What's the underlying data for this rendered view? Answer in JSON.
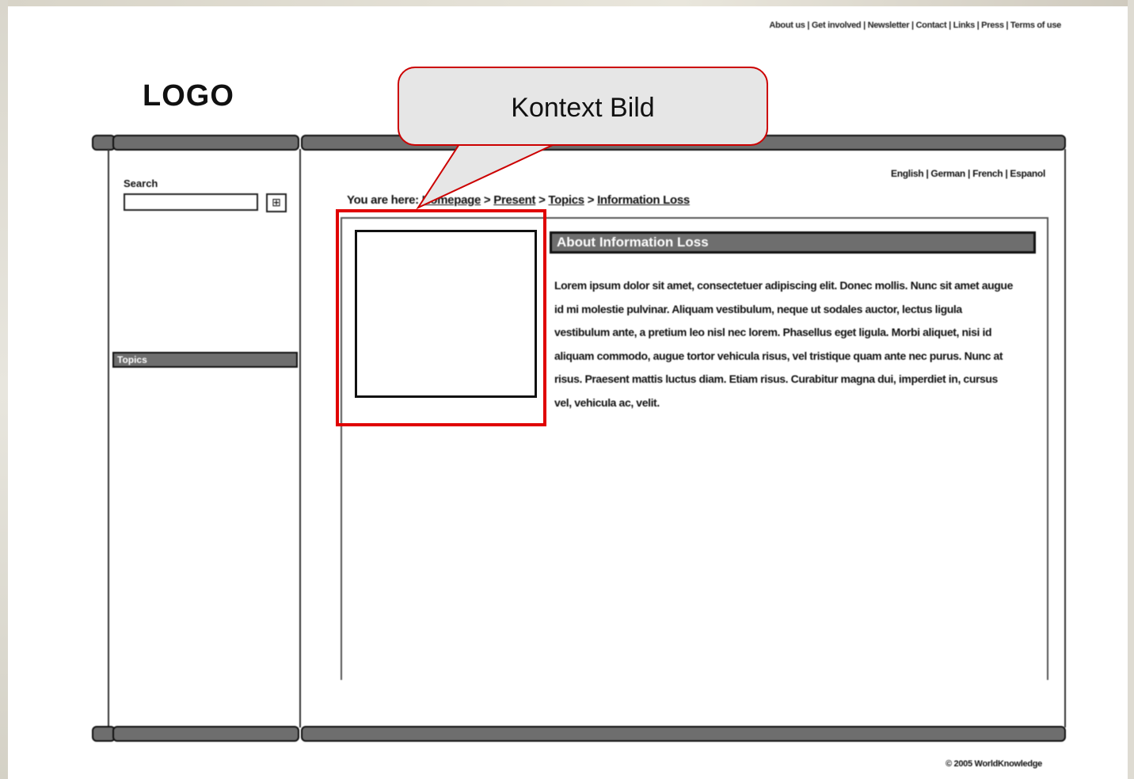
{
  "header": {
    "top_links": "About us | Get involved | Newsletter | Contact | Links | Press | Terms of use",
    "logo": "LOGO"
  },
  "sidebar": {
    "search_label": "Search",
    "search_placeholder": "",
    "search_button": "⊞",
    "topics_label": "Topics"
  },
  "main": {
    "languages": "English | German | French | Espanol",
    "breadcrumb": {
      "prefix": "You are here:",
      "items": [
        "Homepage",
        "Present",
        "Topics",
        "Information Loss"
      ],
      "separator": ">"
    },
    "section_title": "About Information Loss",
    "body": "Lorem ipsum dolor sit amet, consectetuer adipiscing elit. Donec mollis. Nunc sit amet augue id mi molestie pulvinar. Aliquam vestibulum, neque ut sodales auctor, lectus ligula vestibulum ante, a pretium leo nisl nec lorem. Phasellus eget ligula. Morbi aliquet, nisi id aliquam commodo, augue tortor vehicula risus, vel tristique quam ante nec purus. Nunc at risus. Praesent mattis luctus diam. Etiam risus. Curabitur magna dui, imperdiet in, cursus vel, vehicula ac, velit."
  },
  "footer": {
    "copyright": "© 2005 WorldKnowledge"
  },
  "annotation": {
    "callout": "Kontext Bild",
    "highlight_color": "#e00000"
  }
}
